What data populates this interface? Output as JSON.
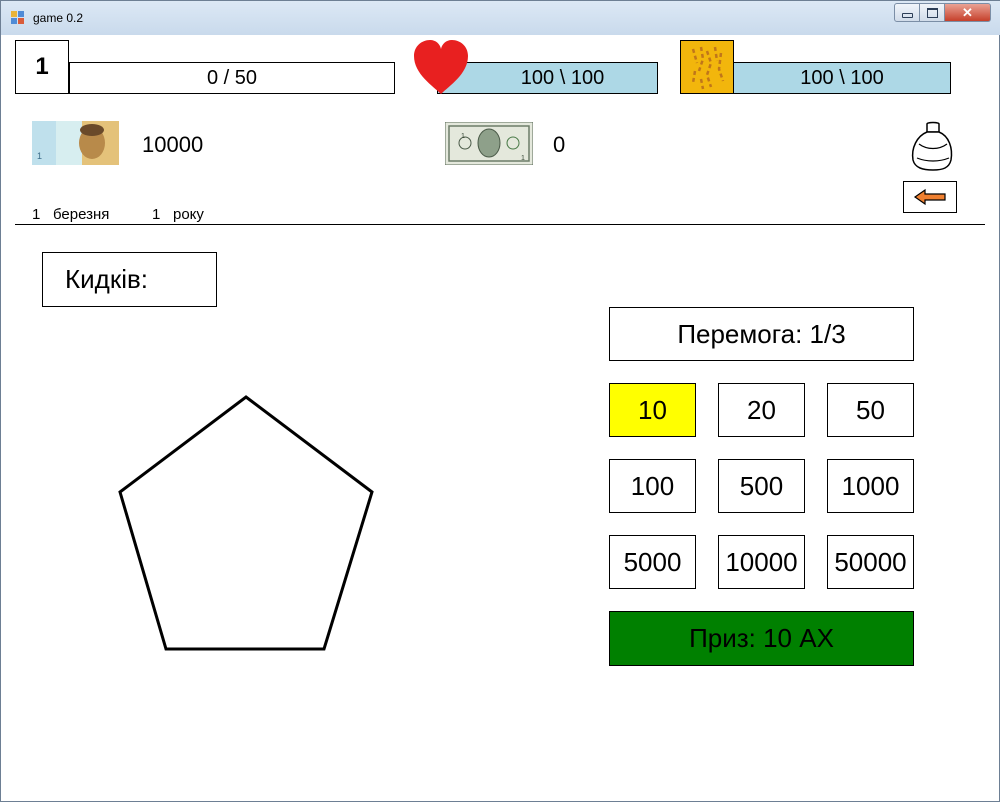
{
  "window": {
    "title": "game 0.2",
    "controls": {
      "close_label": "✕"
    }
  },
  "stats": {
    "level": "1",
    "xp": "0  /  50",
    "health": "100 \\ 100",
    "energy": "100 \\ 100"
  },
  "money": {
    "uah_value": "10000",
    "usd_value": "0"
  },
  "date": {
    "day": "1",
    "month": "березня",
    "year_num": "1",
    "year_word": "року"
  },
  "game": {
    "throws_label": "Кидків:",
    "win_label": "Перемога: 1/3",
    "bets": [
      "10",
      "20",
      "50",
      "100",
      "500",
      "1000",
      "5000",
      "10000",
      "50000"
    ],
    "selected_bet": "10",
    "prize_label": "Приз: 10 АХ"
  },
  "colors": {
    "bar_fill": "#add8e6",
    "selected_bet": "#ffff00",
    "prize_bg": "#008000",
    "energy_icon_bg": "#f2b60c",
    "heart": "#e82020"
  },
  "icons": {
    "app": "app-window-icon",
    "health": "heart-icon",
    "energy": "energy-icon",
    "uah": "hryvnia-banknote-icon",
    "usd": "dollar-banknote-icon",
    "bag": "bag-icon",
    "back": "arrow-left-icon"
  }
}
